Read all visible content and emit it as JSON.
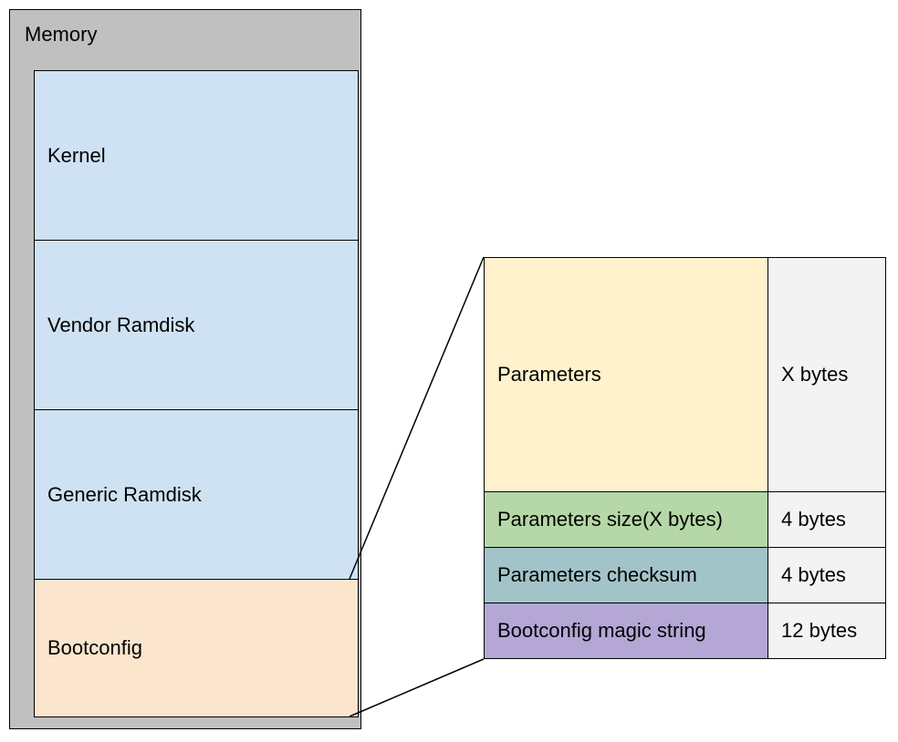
{
  "memory": {
    "title": "Memory",
    "sections": [
      {
        "label": "Kernel"
      },
      {
        "label": "Vendor Ramdisk"
      },
      {
        "label": "Generic Ramdisk"
      },
      {
        "label": "Bootconfig"
      }
    ]
  },
  "bootconfig_detail": {
    "rows": [
      {
        "label": "Parameters",
        "size": "X bytes"
      },
      {
        "label": "Parameters size(X bytes)",
        "size": "4 bytes"
      },
      {
        "label": "Parameters checksum",
        "size": "4 bytes"
      },
      {
        "label": "Bootconfig magic string",
        "size": "12 bytes"
      }
    ]
  },
  "colors": {
    "memory_bg": "#c0c0c0",
    "blue": "#cfe2f3",
    "peach": "#fce5cd",
    "cream": "#fff2cc",
    "green": "#b6d7a8",
    "teal": "#a2c4c9",
    "purple": "#b4a7d6",
    "grey": "#f3f3f3"
  }
}
